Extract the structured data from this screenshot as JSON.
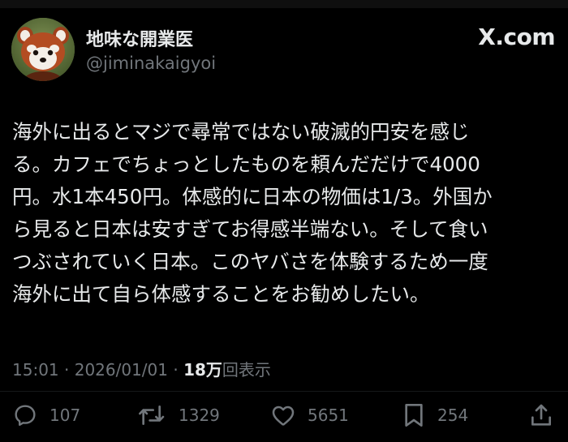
{
  "user": {
    "display_name": "地味な開業医",
    "handle": "@jiminakaigyoi",
    "avatar_icon": "red-panda-avatar"
  },
  "source": {
    "label": "X.com"
  },
  "tweet": {
    "lines": [
      "海外に出るとマジで尋常ではない破滅的円安を感じ",
      "る。カフェでちょっとしたものを頼んだだけで4000",
      "円。水1本450円。体感的に日本の物価は1/3。外国か",
      "ら見ると日本は安すぎてお得感半端ない。そして食い",
      "つぶされていく日本。このヤバさを体験するため一度",
      "海外に出て自ら体感することをお勧めしたい。"
    ]
  },
  "meta": {
    "time": "15:01",
    "separator": " · ",
    "date": "2026/01/01",
    "views_count": "18万",
    "views_label": "回表示"
  },
  "actions": {
    "reply": {
      "icon": "reply-icon",
      "count": "107"
    },
    "repost": {
      "icon": "repost-icon",
      "count": "1329"
    },
    "like": {
      "icon": "heart-icon",
      "count": "5651"
    },
    "bookmark": {
      "icon": "bookmark-icon",
      "count": "254"
    },
    "share": {
      "icon": "share-icon"
    }
  },
  "colors": {
    "background": "#000000",
    "primary_text": "#e7e9ea",
    "secondary_text": "#71767b"
  }
}
